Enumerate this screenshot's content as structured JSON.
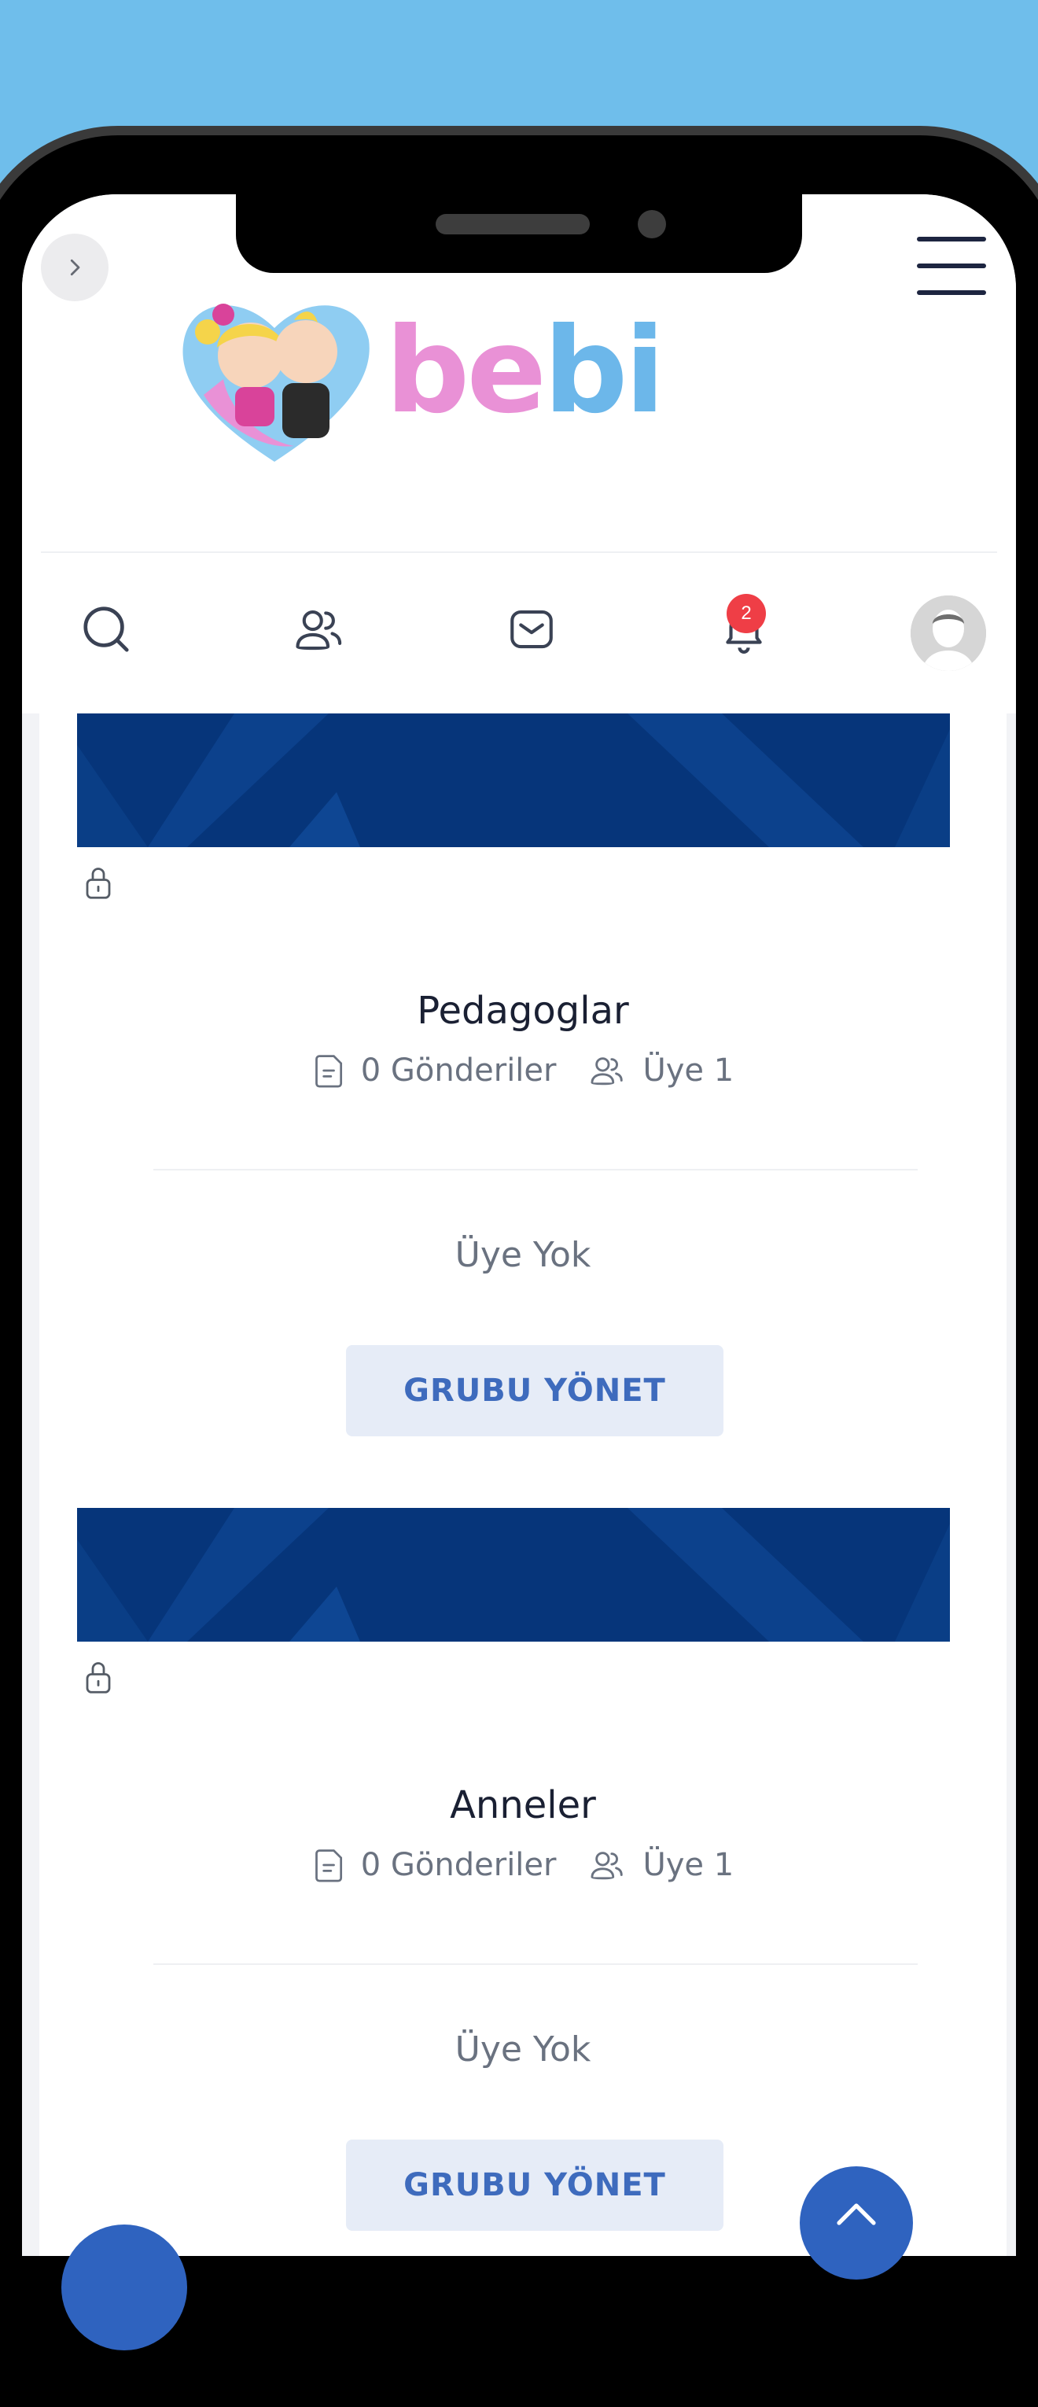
{
  "brand": {
    "logo_text_pink": "be",
    "logo_text_blue": "bi"
  },
  "nav": {
    "items": [
      {
        "icon": "search-icon"
      },
      {
        "icon": "users-icon"
      },
      {
        "icon": "mail-icon"
      },
      {
        "icon": "bell-icon",
        "badge": "2"
      },
      {
        "icon": "avatar"
      }
    ]
  },
  "groups": [
    {
      "name": "Pedagoglar",
      "posts": "0 Gönderiler",
      "members": "Üye 1",
      "empty_text": "Üye Yok",
      "manage_label": "GRUBU YÖNET"
    },
    {
      "name": "Anneler",
      "posts": "0 Gönderiler",
      "members": "Üye 1",
      "empty_text": "Üye Yok",
      "manage_label": "GRUBU YÖNET"
    }
  ],
  "colors": {
    "background": "#6fbeeb",
    "banner": "#06357a",
    "accent": "#2f63bf",
    "badge": "#ef3e46",
    "logo_pink": "#e991d6",
    "logo_blue": "#6cb7ea"
  }
}
